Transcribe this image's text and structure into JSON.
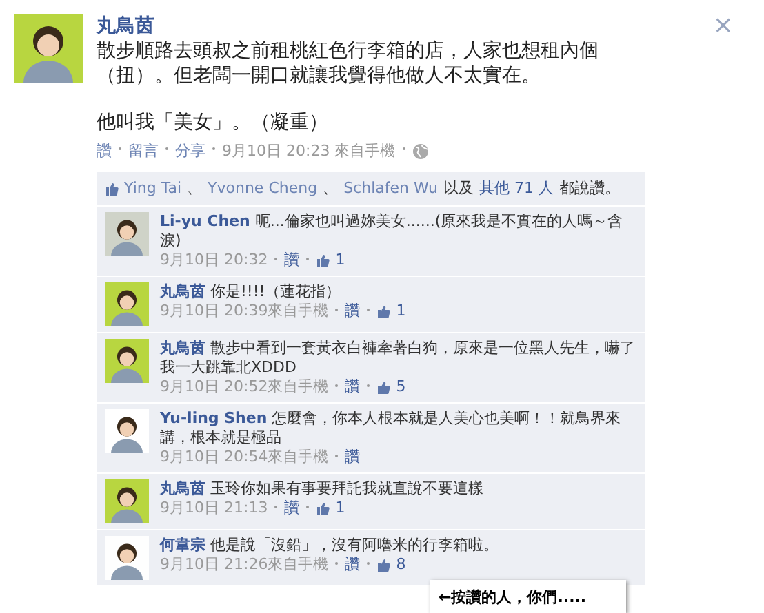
{
  "post": {
    "author": "丸鳥茵",
    "text_lines": [
      "散步順路去頭叔之前租桃紅色行李箱的店，人家也想租內個",
      "（扭）。但老闆一開口就讓我覺得他做人不太實在。"
    ],
    "text_after": "他叫我「美女」。（凝重）",
    "actions": [
      "讚",
      "留言",
      "分享"
    ],
    "time": "9月10日 20:23 來自手機",
    "close": "×"
  },
  "likes": {
    "names": [
      "Ying Tai",
      "Yvonne Cheng",
      "Schlafen Wu"
    ],
    "separator": "、",
    "and_others": "以及",
    "others_link": "其他 71 人",
    "suffix": "都說讚。"
  },
  "comments": [
    {
      "author": "Li-yu Chen",
      "color": "#cfd3c8",
      "text": "呃...倫家也叫過妳美女......(原來我是不實在的人嗎～含淚)",
      "time": "9月10日 20:32",
      "like_link": "讚",
      "like_count": "1"
    },
    {
      "author": "丸鳥茵",
      "color": "#b8d640",
      "text": "你是!!!!（蓮花指）",
      "time": "9月10日 20:39來自手機",
      "like_link": "讚",
      "like_count": "1"
    },
    {
      "author": "丸鳥茵",
      "color": "#b8d640",
      "text": "散步中看到一套黃衣白褲牽著白狗，原來是一位黑人先生，嚇了我一大跳靠北XDDD",
      "time": "9月10日 20:52來自手機",
      "like_link": "讚",
      "like_count": "5"
    },
    {
      "author": "Yu-ling Shen",
      "color": "#ffffff",
      "text": "怎麼會，你本人根本就是人美心也美啊！！就鳥界來講，根本就是極品",
      "time": "9月10日 20:54來自手機",
      "like_link": "讚"
    },
    {
      "author": "丸鳥茵",
      "color": "#b8d640",
      "text": "玉玲你如果有事要拜託我就直說不要這樣",
      "time": "9月10日 21:13",
      "like_link": "讚",
      "like_count": "1"
    },
    {
      "author": "何韋宗",
      "color": "#fefefe",
      "text": "他是說「沒鉛」，沒有阿嚕米的行李箱啦。",
      "time": "9月10日 21:26來自手機",
      "like_link": "讚",
      "like_count": "8"
    }
  ],
  "annotation": "←按讚的人，你們....."
}
